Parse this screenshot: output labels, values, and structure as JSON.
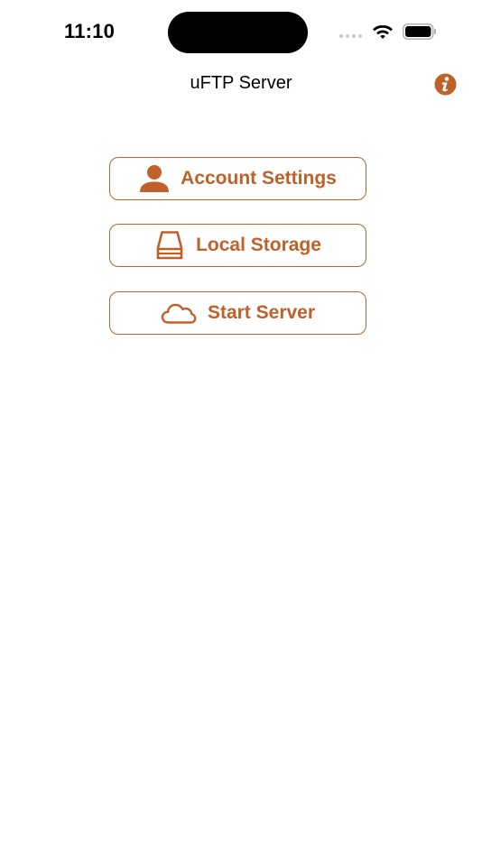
{
  "status_bar": {
    "time": "11:10",
    "signal_icon": "cellular-dots-icon",
    "wifi_icon": "wifi-icon",
    "battery_icon": "battery-full-icon"
  },
  "nav": {
    "title": "uFTP Server",
    "info_icon": "info-icon"
  },
  "accent_color": "#c0602a",
  "menu": [
    {
      "label": "Account Settings",
      "icon": "person-icon"
    },
    {
      "label": "Local Storage",
      "icon": "drive-icon"
    },
    {
      "label": "Start Server",
      "icon": "cloud-icon"
    }
  ]
}
